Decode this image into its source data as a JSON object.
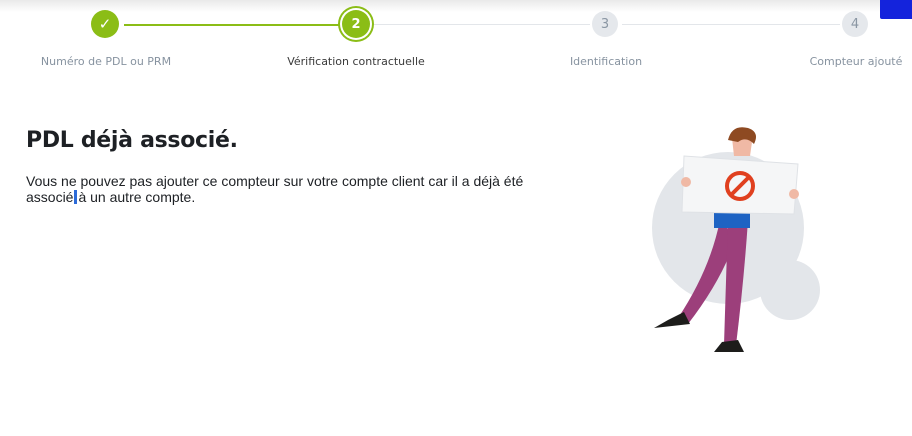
{
  "stepper": {
    "steps": [
      {
        "number": "",
        "label": "Numéro de PDL ou PRM",
        "state": "done",
        "icon": "check-icon"
      },
      {
        "number": "2",
        "label": "Vérification contractuelle",
        "state": "active"
      },
      {
        "number": "3",
        "label": "Identification",
        "state": "todo"
      },
      {
        "number": "4",
        "label": "Compteur ajouté",
        "state": "todo"
      }
    ]
  },
  "main": {
    "title": "PDL déjà associé.",
    "message_part1": "Vous ne pouvez pas ajouter ce compteur sur votre compte client car il a déjà été associé",
    "message_part2": "à un autre compte."
  },
  "colors": {
    "accent": "#8bbd16",
    "brand_blue": "#1423dc",
    "pending": "#e5e8ec",
    "forbidden_red": "#e0401f",
    "pants": "#9c3f7b",
    "shirt": "#1e63c3"
  },
  "illustration": {
    "icon": "no-entry-icon"
  }
}
